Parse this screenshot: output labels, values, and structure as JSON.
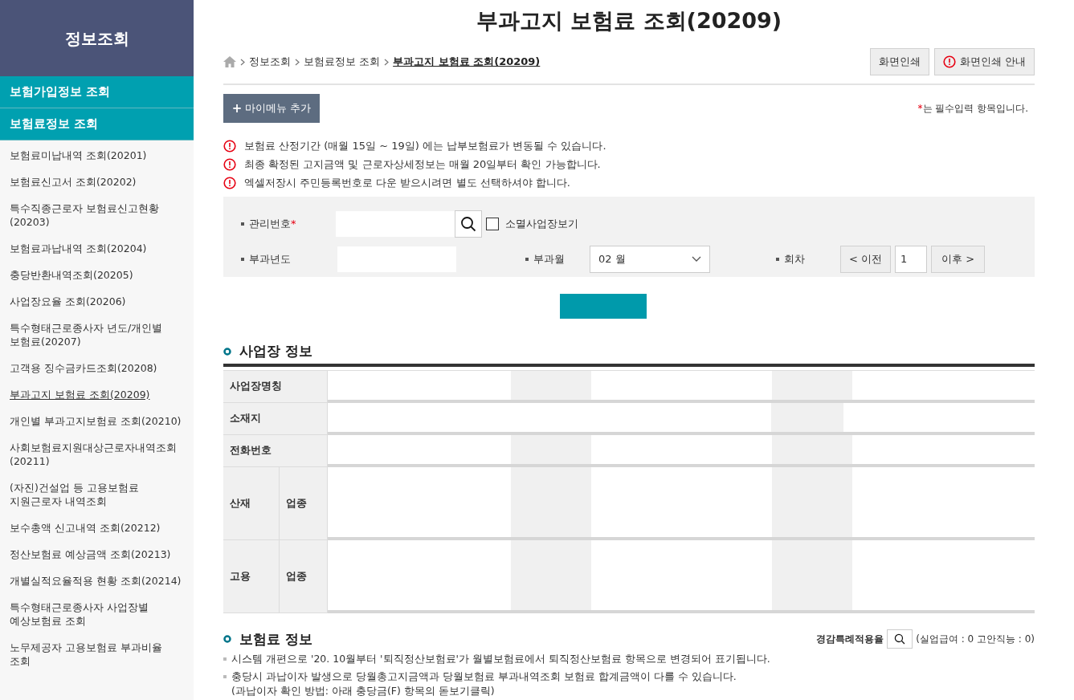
{
  "sidebar": {
    "title": "정보조회",
    "sections": [
      {
        "label": "보험가입정보 조회"
      },
      {
        "label": "보험료정보 조회"
      }
    ],
    "items": [
      {
        "lines": [
          "보험료미납내역 조회(20201)"
        ],
        "selected": false
      },
      {
        "lines": [
          "보험료신고서 조회(20202)"
        ],
        "selected": false
      },
      {
        "lines": [
          "특수직종근로자 보험료신고현황",
          "(20203)"
        ],
        "selected": false
      },
      {
        "lines": [
          "보험료과납내역 조회(20204)"
        ],
        "selected": false
      },
      {
        "lines": [
          "충당반환내역조회(20205)"
        ],
        "selected": false
      },
      {
        "lines": [
          "사업장요율 조회(20206)"
        ],
        "selected": false
      },
      {
        "lines": [
          "특수형태근로종사자 년도/개인별",
          "보험료(20207)"
        ],
        "selected": false
      },
      {
        "lines": [
          "고객용 징수금카드조회(20208)"
        ],
        "selected": false
      },
      {
        "lines": [
          "부과고지 보험료 조회(20209)"
        ],
        "selected": true
      },
      {
        "lines": [
          "개인별 부과고지보험료 조회(20210)"
        ],
        "selected": false
      },
      {
        "lines": [
          "사회보험료지원대상근로자내역조회",
          "(20211)"
        ],
        "selected": false
      },
      {
        "lines": [
          "(자진)건설업 등 고용보험료",
          "지원근로자 내역조회"
        ],
        "selected": false
      },
      {
        "lines": [
          "보수총액 신고내역 조회(20212)"
        ],
        "selected": false
      },
      {
        "lines": [
          "정산보험료 예상금액 조회(20213)"
        ],
        "selected": false
      },
      {
        "lines": [
          "개별실적요율적용 현황 조회(20214)"
        ],
        "selected": false
      },
      {
        "lines": [
          "특수형태근로종사자 사업장별",
          "예상보험료 조회"
        ],
        "selected": false
      },
      {
        "lines": [
          "노무제공자 고용보험료 부과비율",
          "조회"
        ],
        "selected": false
      }
    ]
  },
  "page_title": "부과고지 보험료 조회(20209)",
  "breadcrumb": [
    {
      "label": "정보조회",
      "current": false
    },
    {
      "label": "보험료정보 조회",
      "current": false
    },
    {
      "label": "부과고지 보험료 조회(20209)",
      "current": true
    }
  ],
  "print_buttons": [
    {
      "label": "화면인쇄",
      "kind": "plain"
    },
    {
      "label": "화면인쇄 안내",
      "kind": "info"
    }
  ],
  "mymenu_button": {
    "icon": "+",
    "label": "마이메뉴 추가"
  },
  "required_note": {
    "mark": "*",
    "text": "는 필수입력 항목입니다."
  },
  "notices": [
    "보험료 산정기간 (매월 15일 ~ 19일) 에는 납부보험료가 변동될 수 있습니다.",
    "최종 확정된 고지금액 및 근로자상세정보는 매월 20일부터 확인 가능합니다.",
    "엑셀저장시 주민등록번호로 다운 받으시려면 별도 선택하셔야 합니다."
  ],
  "search_form": {
    "management_no": {
      "label": "관리번호",
      "required": true
    },
    "closed_checkbox": {
      "label": "소멸사업장보기",
      "checked": false
    },
    "year": {
      "label": "부과년도"
    },
    "month": {
      "label": "부과월",
      "value": "02 월"
    },
    "round": {
      "label": "회차",
      "prev": "< 이전",
      "value": "1",
      "next": "이후 >"
    }
  },
  "workplace": {
    "title": "사업장 정보",
    "rows": [
      {
        "label": "사업장명칭",
        "kind": "single"
      },
      {
        "label": "소재지",
        "kind": "wide"
      },
      {
        "label": "전화번호",
        "kind": "single"
      },
      {
        "label": "산재",
        "sublabel": "업종",
        "kind": "split"
      },
      {
        "label": "고용",
        "sublabel": "업종",
        "kind": "split"
      }
    ]
  },
  "premium": {
    "title": "보험료 정보",
    "rate_label": "경감특례적용율",
    "rate_text": "(실업급여 : 0 고안직능 : 0)",
    "bullets": [
      {
        "lines": [
          "시스템 개편으로 '20. 10월부터 '퇴직정산보험료'가 월별보험료에서 퇴직정산보험료 항목으로 변경되어 표기됩니다."
        ]
      },
      {
        "lines": [
          "충당시 과납이자 발생으로 당월총고지금액과 당월보험료 부과내역조회 보험료 합계금액이 다를 수 있습니다.",
          "(과납이자 확인 방법: 아래 충당금(F) 항목의 돋보기클릭)"
        ]
      }
    ]
  }
}
